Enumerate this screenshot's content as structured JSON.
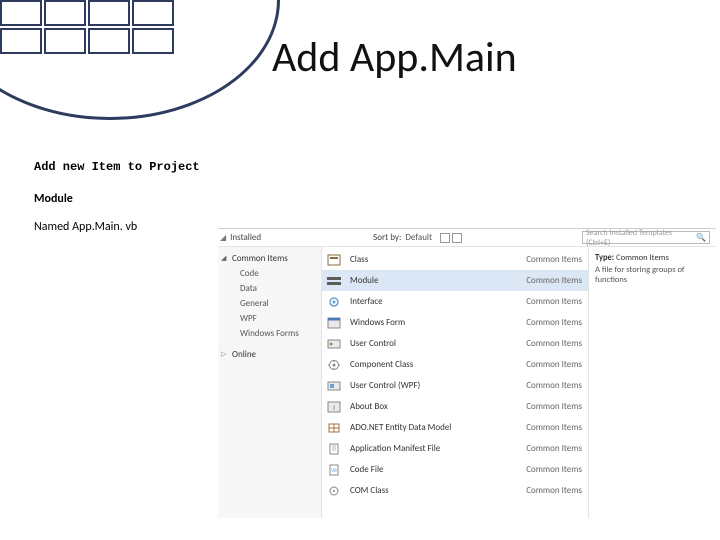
{
  "slide": {
    "title": "Add App.Main",
    "instr1": "Add new Item to Project",
    "instr2": "Module",
    "instr3": "Named App.Main. vb"
  },
  "dialog": {
    "installed_label": "Installed",
    "sort_label": "Sort by:",
    "sort_value": "Default",
    "search_placeholder": "Search Installed Templates (Ctrl+E)",
    "tree": {
      "parent": "Common Items",
      "children": [
        "Code",
        "Data",
        "General",
        "WPF",
        "Windows Forms"
      ],
      "online": "Online"
    },
    "templates": [
      {
        "name": "Class",
        "cat": "Common Items",
        "icon": "class"
      },
      {
        "name": "Module",
        "cat": "Common Items",
        "icon": "module"
      },
      {
        "name": "Interface",
        "cat": "Common Items",
        "icon": "interface"
      },
      {
        "name": "Windows Form",
        "cat": "Common Items",
        "icon": "form"
      },
      {
        "name": "User Control",
        "cat": "Common Items",
        "icon": "usercontrol"
      },
      {
        "name": "Component Class",
        "cat": "Common Items",
        "icon": "component"
      },
      {
        "name": "User Control (WPF)",
        "cat": "Common Items",
        "icon": "usercontrolwpf"
      },
      {
        "name": "About Box",
        "cat": "Common Items",
        "icon": "about"
      },
      {
        "name": "ADO.NET Entity Data Model",
        "cat": "Common Items",
        "icon": "ado"
      },
      {
        "name": "Application Manifest File",
        "cat": "Common Items",
        "icon": "manifest"
      },
      {
        "name": "Code File",
        "cat": "Common Items",
        "icon": "codefile"
      },
      {
        "name": "COM Class",
        "cat": "Common Items",
        "icon": "com"
      }
    ],
    "selected_index": 1,
    "detail": {
      "type_label": "Type:",
      "type_value": "Common Items",
      "desc": "A file for storing groups of functions"
    }
  }
}
